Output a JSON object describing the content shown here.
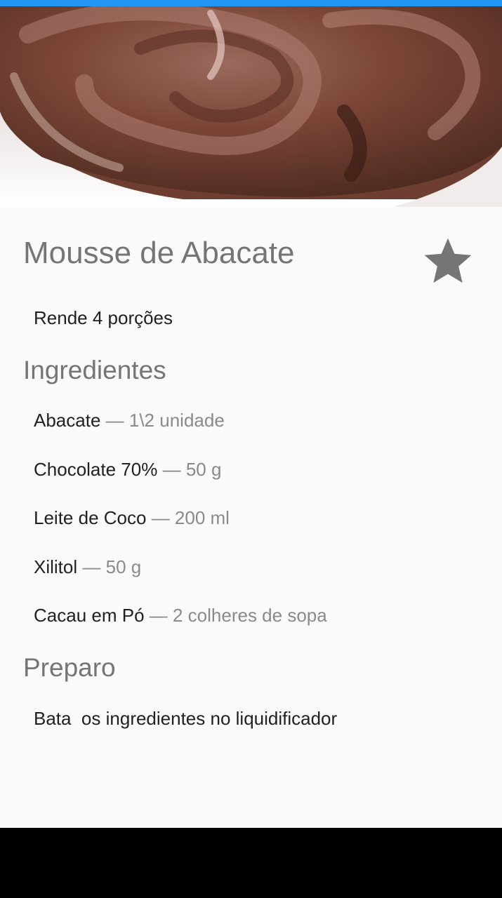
{
  "colors": {
    "status_bar": "#2196f3",
    "background": "#fafafa",
    "title_text": "#757575",
    "body_text": "#212121",
    "muted_text": "#8a8a8a",
    "star": "#757575",
    "nav_bar": "#000000"
  },
  "hero": {
    "image_icon": "chocolate-mousse-photo"
  },
  "recipe": {
    "title": "Mousse de Abacate",
    "favorite_icon": "star-icon",
    "servings": "Rende 4 porções"
  },
  "ingredients_section": {
    "title": "Ingredientes",
    "separator": "—",
    "items": [
      {
        "name": "Abacate",
        "quantity": "1\\2 unidade"
      },
      {
        "name": "Chocolate 70%",
        "quantity": "50 g"
      },
      {
        "name": "Leite de Coco",
        "quantity": "200 ml"
      },
      {
        "name": "Xilitol",
        "quantity": "50 g"
      },
      {
        "name": "Cacau em Pó",
        "quantity": "2 colheres de sopa"
      }
    ]
  },
  "preparation_section": {
    "title": "Preparo",
    "steps": [
      "Bata  os ingredientes no liquidificador"
    ]
  }
}
